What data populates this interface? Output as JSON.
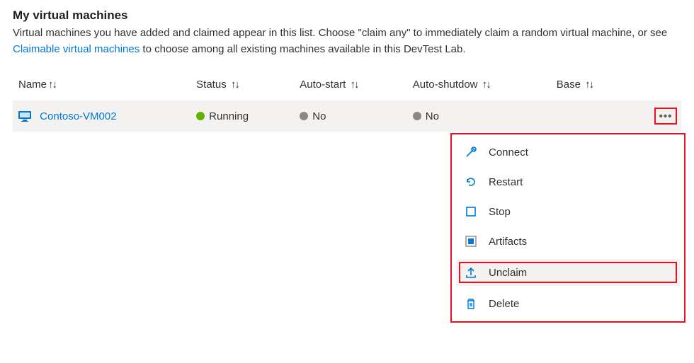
{
  "header": {
    "title": "My virtual machines",
    "desc_pre": "Virtual machines you have added and claimed appear in this list. Choose \"claim any\" to immediately claim a random virtual machine, or see ",
    "desc_link": "Claimable virtual machines",
    "desc_post": " to choose among all existing machines available in this DevTest Lab."
  },
  "columns": {
    "name": "Name",
    "status": "Status",
    "autostart": "Auto-start",
    "autoshutdown": "Auto-shutdow",
    "base": "Base",
    "sort_glyph": "↑↓"
  },
  "row": {
    "name": "Contoso-VM002",
    "status": "Running",
    "autostart": "No",
    "autoshutdown": "No"
  },
  "menu": {
    "connect": "Connect",
    "restart": "Restart",
    "stop": "Stop",
    "artifacts": "Artifacts",
    "unclaim": "Unclaim",
    "delete": "Delete"
  }
}
